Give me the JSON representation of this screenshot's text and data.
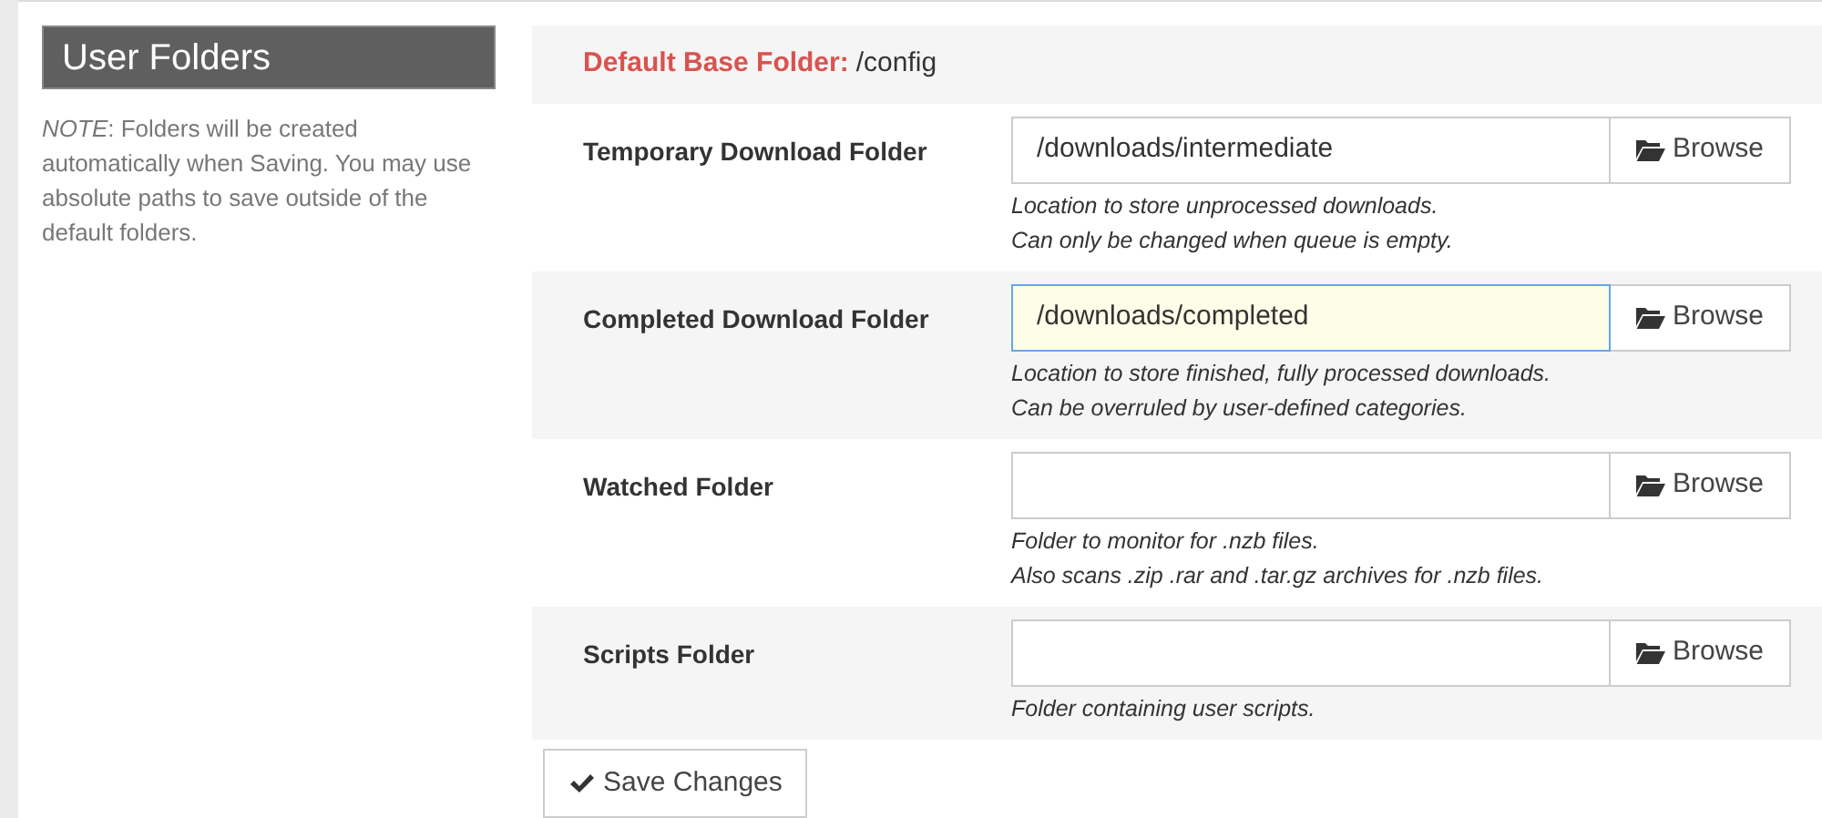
{
  "section": {
    "title": "User Folders",
    "note": "*NOTE*: Folders will be created automatically when Saving. You may use absolute paths to save outside of the default folders."
  },
  "base_folder": {
    "label": "Default Base Folder:",
    "value": "/config"
  },
  "fields": [
    {
      "label": "Temporary Download Folder",
      "value": "/downloads/intermediate",
      "focused": false,
      "button": "Browse",
      "help": [
        "Location to store unprocessed downloads.",
        "Can only be changed when queue is empty."
      ]
    },
    {
      "label": "Completed Download Folder",
      "value": "/downloads/completed",
      "focused": true,
      "button": "Browse",
      "help": [
        "Location to store finished, fully processed downloads.",
        "Can be overruled by user-defined categories."
      ]
    },
    {
      "label": "Watched Folder",
      "focused": false,
      "button": "Browse",
      "help": [
        "Folder to monitor for .nzb files.",
        "Also scans .zip .rar and .tar.gz archives for .nzb files."
      ]
    },
    {
      "label": "Scripts Folder",
      "focused": false,
      "button": "Browse",
      "help": [
        "Folder containing user scripts."
      ]
    }
  ],
  "save_button": "Save Changes"
}
